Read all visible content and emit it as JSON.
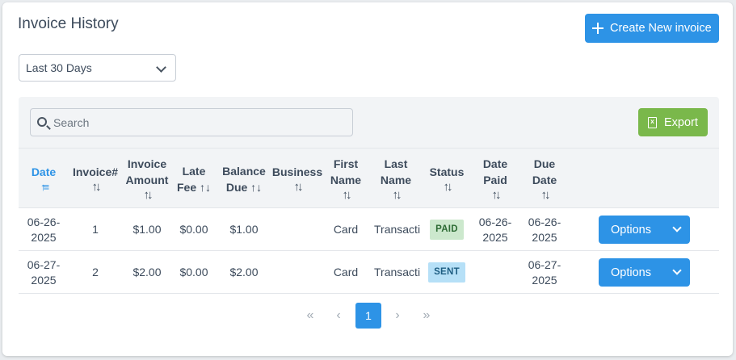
{
  "header": {
    "title": "Invoice History",
    "create_label": "Create New invoice"
  },
  "filter": {
    "selected": "Last 30 Days"
  },
  "toolbar": {
    "search_placeholder": "Search",
    "export_label": "Export"
  },
  "columns": [
    {
      "l1": "Date",
      "l2": "",
      "sort": "↑≡",
      "active": true
    },
    {
      "l1": "Invoice#",
      "l2": "",
      "sort": "↑↓"
    },
    {
      "l1": "Invoice",
      "l2": "Amount",
      "sort": "↑↓"
    },
    {
      "l1": "Late",
      "l2": "Fee ↑↓",
      "sort": ""
    },
    {
      "l1": "Balance",
      "l2": "Due ↑↓",
      "sort": ""
    },
    {
      "l1": "Business",
      "l2": "",
      "sort": "↑↓"
    },
    {
      "l1": "First",
      "l2": "Name",
      "sort": "↑↓"
    },
    {
      "l1": "Last",
      "l2": "Name",
      "sort": "↑↓"
    },
    {
      "l1": "Status",
      "l2": "",
      "sort": "↑↓"
    },
    {
      "l1": "Date",
      "l2": "Paid",
      "sort": "↑↓"
    },
    {
      "l1": "Due",
      "l2": "Date",
      "sort": "↑↓"
    }
  ],
  "rows": [
    {
      "date_l1": "06-26-",
      "date_l2": "2025",
      "invoice": "1",
      "amount": "$1.00",
      "late_fee": "$0.00",
      "balance": "$1.00",
      "business": "",
      "first": "Card",
      "last": "Transacti",
      "status": "PAID",
      "paid_l1": "06-26-",
      "paid_l2": "2025",
      "due_l1": "06-26-",
      "due_l2": "2025",
      "options": "Options"
    },
    {
      "date_l1": "06-27-",
      "date_l2": "2025",
      "invoice": "2",
      "amount": "$2.00",
      "late_fee": "$0.00",
      "balance": "$2.00",
      "business": "",
      "first": "Card",
      "last": "Transacti",
      "status": "SENT",
      "paid_l1": "",
      "paid_l2": "",
      "due_l1": "06-27-",
      "due_l2": "2025",
      "options": "Options"
    }
  ],
  "pagination": {
    "first": "«",
    "prev": "‹",
    "current": "1",
    "next": "›",
    "last": "»"
  },
  "colors": {
    "primary": "#2d93e6",
    "export": "#7ab84b",
    "paid_bg": "#cce8cd",
    "sent_bg": "#b6e0f7"
  }
}
